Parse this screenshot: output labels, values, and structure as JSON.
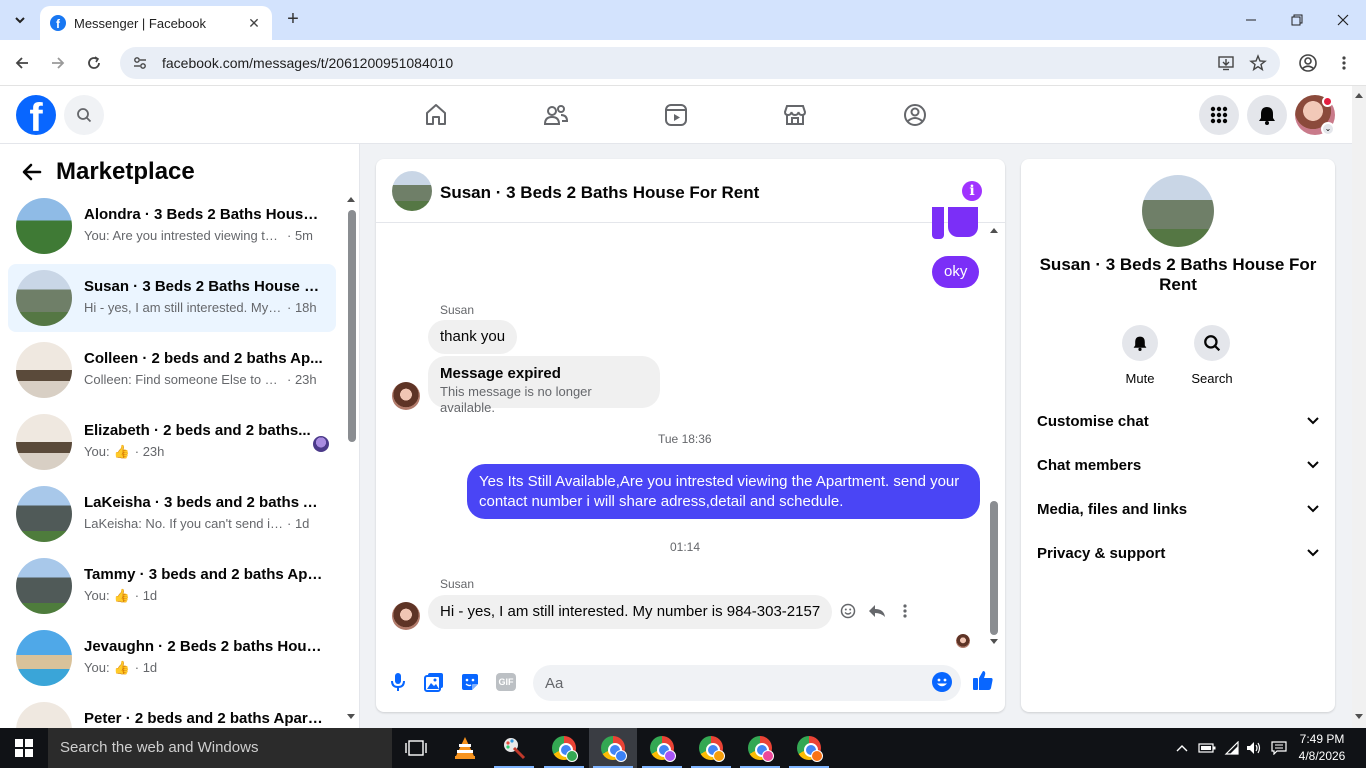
{
  "browser": {
    "tab_title": "Messenger | Facebook",
    "url": "facebook.com/messages/t/2061200951084010"
  },
  "left_panel": {
    "title": "Marketplace",
    "chats": [
      {
        "name": "Alondra · 3 Beds 2 Baths House ...",
        "preview": "You: Are you intrested viewing the ...",
        "time": "· 5m",
        "active": false,
        "like": false
      },
      {
        "name": "Susan · 3 Beds 2 Baths House Fo...",
        "preview": "Hi - yes, I am still interested. My n...",
        "time": "· 18h",
        "active": true,
        "like": false
      },
      {
        "name": "Colleen · 2 beds and 2 baths Ap...",
        "preview": "Colleen: Find someone Else to SC...",
        "time": "· 23h",
        "active": false,
        "like": false
      },
      {
        "name": "Elizabeth · 2 beds and 2 baths...",
        "preview": "You:",
        "time": "· 23h",
        "active": false,
        "like": true
      },
      {
        "name": "LaKeisha · 3 beds and 2 baths A...",
        "preview": "LaKeisha: No. If you can't send it he...",
        "time": "· 1d",
        "active": false,
        "like": false
      },
      {
        "name": "Tammy · 3 beds and 2 baths Apa...",
        "preview": "You:",
        "time": "· 1d",
        "active": false,
        "like": true
      },
      {
        "name": "Jevaughn · 2 Beds 2 baths Hous...",
        "preview": "You:",
        "time": "· 1d",
        "active": false,
        "like": true
      },
      {
        "name": "Peter · 2 beds and 2 baths Apart...",
        "preview": "",
        "time": "",
        "active": false,
        "like": false
      }
    ]
  },
  "conversation": {
    "title": "Susan · 3 Beds 2 Baths House For Rent",
    "messages": {
      "oky": "oky",
      "sender1": "Susan",
      "thank_you": "thank you",
      "expired_title": "Message expired",
      "expired_sub": "This message is no longer available.",
      "stamp1": "Tue 18:36",
      "outgoing_long": "Yes Its Still Available,Are you intrested viewing the Apartment. send your contact number i will share adress,detail and schedule.",
      "stamp2": "01:14",
      "sender2": "Susan",
      "last_in": "Hi - yes, I am still interested. My number is 984-303-2157"
    },
    "composer_placeholder": "Aa",
    "gif_label": "GIF"
  },
  "info_panel": {
    "name": "Susan · 3 Beds 2 Baths House For Rent",
    "mute_label": "Mute",
    "search_label": "Search",
    "sections": [
      "Customise chat",
      "Chat members",
      "Media, files and links",
      "Privacy & support"
    ]
  },
  "taskbar": {
    "search_placeholder": "Search the web and Windows",
    "time": "7:49 PM",
    "date": "4/8/2026"
  },
  "colors": {
    "fb_blue": "#0866ff",
    "messenger_purple": "#7b2ff7",
    "messenger_blue": "#4a45f5",
    "active_chat_bg": "#ebf5ff"
  }
}
